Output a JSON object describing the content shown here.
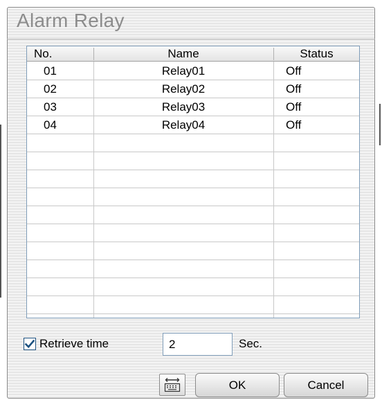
{
  "window": {
    "title": "Alarm Relay"
  },
  "table": {
    "columns": [
      "No.",
      "Name",
      "Status"
    ],
    "rows": [
      {
        "no": "01",
        "name": "Relay01",
        "status": "Off"
      },
      {
        "no": "02",
        "name": "Relay02",
        "status": "Off"
      },
      {
        "no": "03",
        "name": "Relay03",
        "status": "Off"
      },
      {
        "no": "04",
        "name": "Relay04",
        "status": "Off"
      },
      {
        "no": "",
        "name": "",
        "status": ""
      },
      {
        "no": "",
        "name": "",
        "status": ""
      },
      {
        "no": "",
        "name": "",
        "status": ""
      },
      {
        "no": "",
        "name": "",
        "status": ""
      },
      {
        "no": "",
        "name": "",
        "status": ""
      },
      {
        "no": "",
        "name": "",
        "status": ""
      },
      {
        "no": "",
        "name": "",
        "status": ""
      },
      {
        "no": "",
        "name": "",
        "status": ""
      },
      {
        "no": "",
        "name": "",
        "status": ""
      },
      {
        "no": "",
        "name": "",
        "status": ""
      }
    ]
  },
  "retrieve": {
    "label": "Retrieve time",
    "checked": true,
    "value": "2",
    "unit": "Sec."
  },
  "buttons": {
    "keyboard_icon": "keyboard-icon",
    "ok": "OK",
    "cancel": "Cancel"
  },
  "colors": {
    "checkbox_tick": "#1c5180",
    "grid_border": "#7f9db9"
  }
}
